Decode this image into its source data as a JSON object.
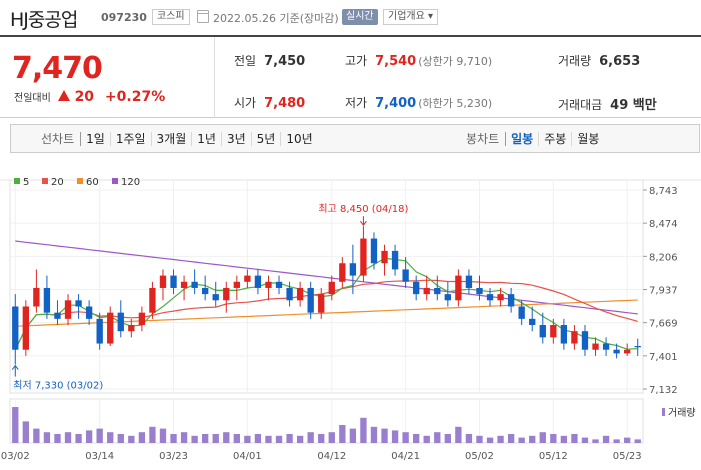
{
  "header": {
    "name": "HJ중공업",
    "code": "097230",
    "market": "코스피",
    "date": "2022.05.26 기준(장마감)",
    "realtime": "실시간",
    "overview": "기업개요 ▾"
  },
  "price": {
    "current": "7,470",
    "change_label": "전일대비",
    "change": "20",
    "change_pct": "+0.27%"
  },
  "stats": {
    "prev_close_label": "전일",
    "prev_close": "7,450",
    "open_label": "시가",
    "open": "7,480",
    "high_label": "고가",
    "high": "7,540",
    "upper_limit": "(상한가 9,710)",
    "low_label": "저가",
    "low": "7,400",
    "lower_limit": "(하한가 5,230)",
    "volume_label": "거래량",
    "volume": "6,653",
    "amount_label": "거래대금",
    "amount": "49 백만"
  },
  "tabs": {
    "line_title": "선차트",
    "line_tabs": [
      "1일",
      "1주일",
      "3개월",
      "1년",
      "3년",
      "5년",
      "10년"
    ],
    "candle_title": "봉차트",
    "candle_tabs": [
      "일봉",
      "주봉",
      "월봉"
    ],
    "active_candle": "일봉"
  },
  "colors": {
    "up": "#e0241f",
    "down": "#1261c4",
    "ma5": "#4caf3e",
    "ma20": "#e8524a",
    "ma60": "#ef8f2c",
    "ma120": "#9c58c8",
    "volume": "#9a7fcf"
  },
  "chart_data": {
    "type": "candlestick",
    "legend": [
      "5",
      "20",
      "60",
      "120"
    ],
    "y_ticks": [
      "8,743",
      "8,474",
      "8,206",
      "7,937",
      "7,669",
      "7,401",
      "7,132"
    ],
    "ylim": [
      7132,
      8743
    ],
    "x_tick_labels": [
      "03/02",
      "03/14",
      "03/23",
      "04/01",
      "04/12",
      "04/21",
      "05/02",
      "05/12",
      "05/23"
    ],
    "x_tick_index": [
      0,
      8,
      15,
      22,
      30,
      37,
      44,
      51,
      58
    ],
    "max_annotation": "최고 8,450 (04/18)",
    "min_annotation": "최저 7,330 (03/02)",
    "volume_label": "거래량",
    "candles": [
      [
        7800,
        7900,
        7330,
        7450
      ],
      [
        7450,
        7850,
        7400,
        7800
      ],
      [
        7800,
        8100,
        7750,
        7950
      ],
      [
        7950,
        8050,
        7700,
        7750
      ],
      [
        7750,
        7850,
        7650,
        7700
      ],
      [
        7700,
        7900,
        7650,
        7850
      ],
      [
        7850,
        7900,
        7700,
        7800
      ],
      [
        7800,
        7850,
        7650,
        7700
      ],
      [
        7700,
        7750,
        7450,
        7500
      ],
      [
        7500,
        7800,
        7480,
        7750
      ],
      [
        7750,
        7850,
        7550,
        7600
      ],
      [
        7600,
        7700,
        7550,
        7650
      ],
      [
        7650,
        7800,
        7600,
        7750
      ],
      [
        7750,
        8000,
        7700,
        7950
      ],
      [
        7950,
        8100,
        7850,
        8050
      ],
      [
        8050,
        8100,
        7900,
        7950
      ],
      [
        7950,
        8050,
        7850,
        8000
      ],
      [
        8000,
        8100,
        7900,
        7950
      ],
      [
        7950,
        8050,
        7850,
        7900
      ],
      [
        7900,
        8000,
        7800,
        7850
      ],
      [
        7850,
        8000,
        7750,
        7950
      ],
      [
        7950,
        8050,
        7850,
        8000
      ],
      [
        8000,
        8100,
        7950,
        8050
      ],
      [
        8050,
        8100,
        7900,
        7950
      ],
      [
        7950,
        8050,
        7850,
        8000
      ],
      [
        8000,
        8050,
        7900,
        7950
      ],
      [
        7950,
        8000,
        7800,
        7850
      ],
      [
        7850,
        8000,
        7800,
        7950
      ],
      [
        7950,
        8000,
        7700,
        7750
      ],
      [
        7750,
        7950,
        7700,
        7900
      ],
      [
        7900,
        8050,
        7850,
        8000
      ],
      [
        8000,
        8200,
        7950,
        8150
      ],
      [
        8150,
        8300,
        7900,
        8050
      ],
      [
        8050,
        8450,
        8000,
        8350
      ],
      [
        8350,
        8400,
        8100,
        8150
      ],
      [
        8150,
        8300,
        8050,
        8250
      ],
      [
        8250,
        8300,
        8050,
        8100
      ],
      [
        8100,
        8200,
        7950,
        8000
      ],
      [
        8000,
        8050,
        7850,
        7900
      ],
      [
        7900,
        8050,
        7850,
        7950
      ],
      [
        7950,
        8050,
        7850,
        7900
      ],
      [
        7900,
        8000,
        7800,
        7850
      ],
      [
        7850,
        8100,
        7800,
        8050
      ],
      [
        8050,
        8100,
        7900,
        7950
      ],
      [
        7950,
        8050,
        7850,
        7900
      ],
      [
        7900,
        7950,
        7800,
        7850
      ],
      [
        7850,
        7950,
        7800,
        7900
      ],
      [
        7900,
        7950,
        7750,
        7800
      ],
      [
        7800,
        7850,
        7650,
        7700
      ],
      [
        7700,
        7800,
        7600,
        7650
      ],
      [
        7650,
        7750,
        7500,
        7550
      ],
      [
        7550,
        7700,
        7500,
        7650
      ],
      [
        7650,
        7700,
        7450,
        7500
      ],
      [
        7500,
        7650,
        7450,
        7600
      ],
      [
        7600,
        7650,
        7400,
        7450
      ],
      [
        7450,
        7550,
        7400,
        7500
      ],
      [
        7500,
        7550,
        7400,
        7450
      ],
      [
        7450,
        7500,
        7380,
        7420
      ],
      [
        7420,
        7500,
        7400,
        7450
      ],
      [
        7480,
        7540,
        7400,
        7470
      ]
    ],
    "volumes": [
      20,
      12,
      8,
      6,
      5,
      6,
      5,
      7,
      8,
      6,
      5,
      4,
      6,
      9,
      8,
      5,
      6,
      4,
      5,
      5,
      6,
      5,
      4,
      5,
      4,
      4,
      5,
      4,
      6,
      5,
      6,
      10,
      8,
      14,
      9,
      8,
      7,
      6,
      5,
      4,
      6,
      5,
      9,
      5,
      4,
      3,
      4,
      5,
      3,
      4,
      6,
      5,
      4,
      5,
      3,
      2,
      4,
      2,
      3,
      2
    ]
  }
}
